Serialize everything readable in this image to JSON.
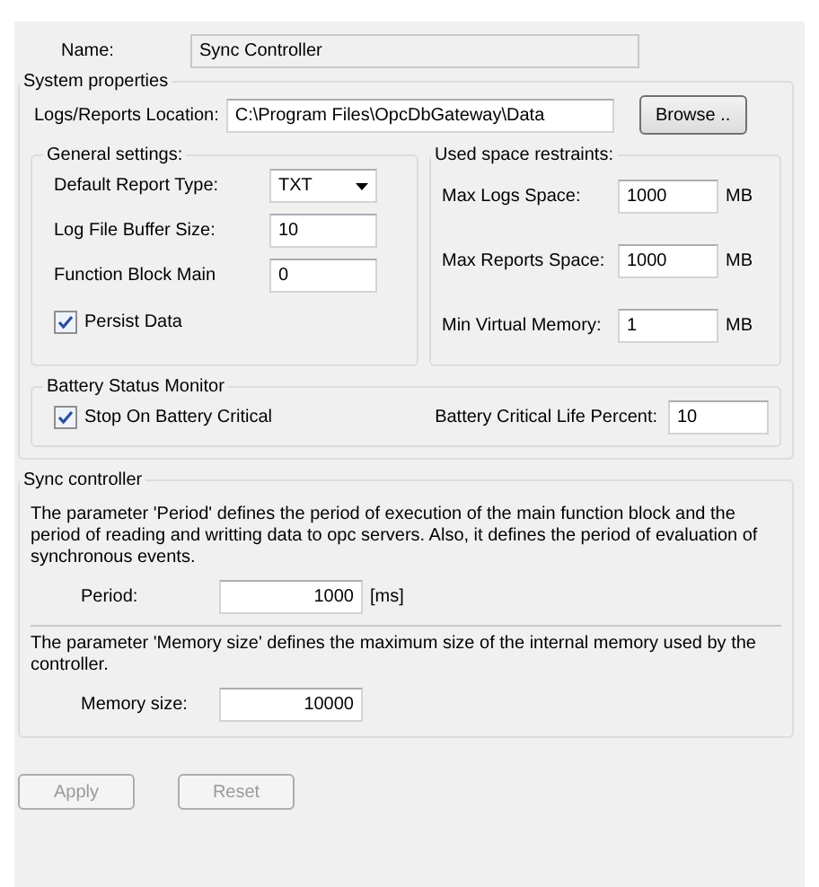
{
  "name": {
    "label": "Name:",
    "value": "Sync Controller",
    "disabled": true
  },
  "system_properties": {
    "title": "System properties",
    "location": {
      "label": "Logs/Reports Location:",
      "value": "C:\\Program Files\\OpcDbGateway\\Data"
    },
    "browse_button": "Browse ..",
    "general_settings": {
      "title": "General settings:",
      "report_type": {
        "label": "Default Report Type:",
        "value": "TXT"
      },
      "buffer_size": {
        "label": "Log File Buffer Size:",
        "value": "10"
      },
      "function_block": {
        "label": "Function Block Main",
        "value": "0"
      },
      "persist_data": {
        "label": "Persist Data",
        "checked": true
      }
    },
    "used_space": {
      "title": "Used space restraints:",
      "rows": [
        {
          "label": "Max Logs Space:",
          "value": "1000",
          "unit": "MB"
        },
        {
          "label": "Max Reports Space:",
          "value": "1000",
          "unit": "MB"
        },
        {
          "label": "Min Virtual Memory:",
          "value": "1",
          "unit": "MB"
        }
      ]
    },
    "battery": {
      "title": "Battery Status Monitor",
      "stop_on_critical": {
        "label": "Stop On Battery Critical",
        "checked": true
      },
      "life_percent": {
        "label": "Battery Critical Life Percent:",
        "value": "10"
      }
    }
  },
  "sync_controller": {
    "title": "Sync controller",
    "period_text": "The parameter 'Period' defines the period of execution of the main function block and the period of reading and writting data to opc servers. Also, it defines the period of evaluation of synchronous events.",
    "period": {
      "label": "Period:",
      "value": "1000",
      "unit": "[ms]"
    },
    "memory_text": "The parameter 'Memory size' defines the maximum size of the internal memory used by the controller.",
    "memory": {
      "label": "Memory size:",
      "value": "10000"
    }
  },
  "buttons": [
    {
      "label": "Apply",
      "disabled": true
    },
    {
      "label": "Reset",
      "disabled": true
    }
  ]
}
